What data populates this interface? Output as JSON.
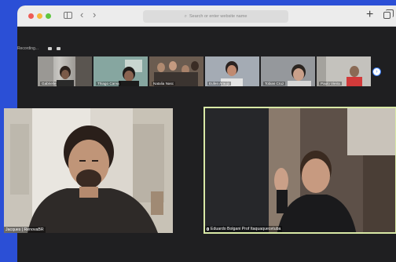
{
  "browser": {
    "url_placeholder": "Search or enter website name"
  },
  "meeting": {
    "recording_label": "Recording..."
  },
  "participants_strip": [
    {
      "name": "Gabrielle"
    },
    {
      "name": "Thiago Carva"
    },
    {
      "name": "Natalia Nasc"
    },
    {
      "name": "Eufen Araujo"
    },
    {
      "name": "Tobias Cruz"
    },
    {
      "name": "Paulo Vieira"
    }
  ],
  "tiles": {
    "left_name": "Jacques | RenovaBR",
    "right_name": "Eduardo Bolgani Prof Itaquaquecetuba"
  },
  "colors": {
    "desktop": "#2b4fd6",
    "active_speaker_border": "#d9e9a6",
    "app_background": "#1f1f21"
  }
}
